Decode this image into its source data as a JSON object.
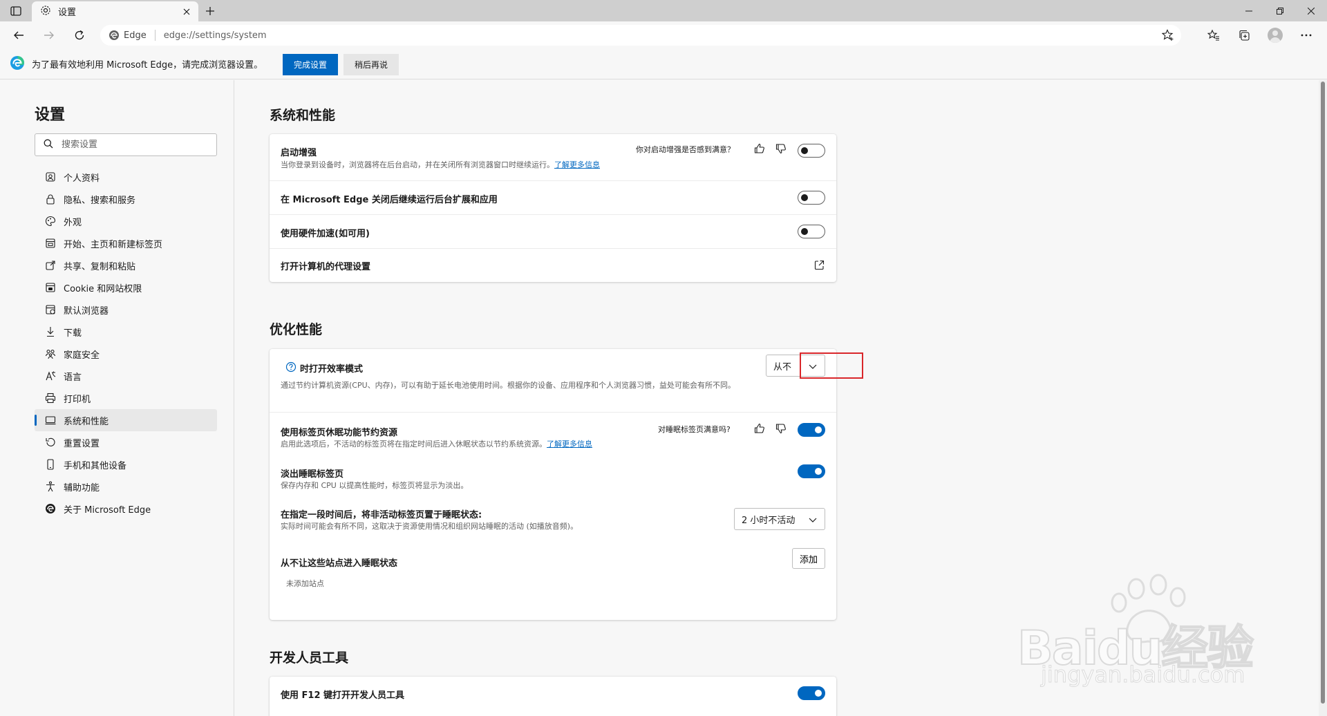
{
  "tab": {
    "title": "设置"
  },
  "address_bar": {
    "site_label": "Edge",
    "url": "edge://settings/system"
  },
  "infobar": {
    "message": "为了最有效地利用 Microsoft Edge，请完成浏览器设置。",
    "primary_button": "完成设置",
    "secondary_button": "稍后再说"
  },
  "sidebar": {
    "title": "设置",
    "search_placeholder": "搜索设置",
    "items": [
      {
        "label": "个人资料",
        "icon": "profile-icon"
      },
      {
        "label": "隐私、搜索和服务",
        "icon": "lock-icon"
      },
      {
        "label": "外观",
        "icon": "appearance-icon"
      },
      {
        "label": "开始、主页和新建标签页",
        "icon": "home-tab-icon"
      },
      {
        "label": "共享、复制和粘贴",
        "icon": "share-icon"
      },
      {
        "label": "Cookie 和网站权限",
        "icon": "site-permissions-icon"
      },
      {
        "label": "默认浏览器",
        "icon": "default-browser-icon"
      },
      {
        "label": "下载",
        "icon": "download-icon"
      },
      {
        "label": "家庭安全",
        "icon": "family-icon"
      },
      {
        "label": "语言",
        "icon": "language-icon"
      },
      {
        "label": "打印机",
        "icon": "printer-icon"
      },
      {
        "label": "系统和性能",
        "icon": "system-icon",
        "active": true
      },
      {
        "label": "重置设置",
        "icon": "reset-icon"
      },
      {
        "label": "手机和其他设备",
        "icon": "phone-icon"
      },
      {
        "label": "辅助功能",
        "icon": "accessibility-icon"
      },
      {
        "label": "关于 Microsoft Edge",
        "icon": "edge-logo-icon"
      }
    ]
  },
  "system_section": {
    "title": "系统和性能",
    "startup_boost": {
      "title": "启动增强",
      "desc": "当你登录到设备时，浏览器将在后台启动，并在关闭所有浏览器窗口时继续运行。",
      "link": "了解更多信息",
      "feedback_question": "你对启动增强是否感到满意？",
      "enabled": false
    },
    "background_extensions": {
      "title": "在 Microsoft Edge 关闭后继续运行后台扩展和应用",
      "enabled": false
    },
    "hardware_accel": {
      "title": "使用硬件加速(如可用)",
      "enabled": false
    },
    "proxy": {
      "title": "打开计算机的代理设置"
    }
  },
  "performance_section": {
    "title": "优化性能",
    "efficiency_mode": {
      "title": "时打开效率模式",
      "desc": "通过节约计算机资源(CPU、内存)，可以有助于延长电池使用时间。根据你的设备、应用程序和个人浏览器习惯，益处可能会有所不同。",
      "selected": "从不"
    },
    "sleeping_tabs": {
      "title": "使用标签页休眠功能节约资源",
      "desc": "启用此选项后，不活动的标签页将在指定时间后进入休眠状态以节约系统资源。",
      "link": "了解更多信息",
      "feedback_question": "对睡眠标签页满意吗?",
      "enabled": true
    },
    "fade_sleeping": {
      "title": "淡出睡眠标签页",
      "desc": "保存内存和 CPU 以提高性能时，标签页将显示为淡出。",
      "enabled": true
    },
    "sleep_after": {
      "title": "在指定一段时间后，将非活动标签页置于睡眠状态:",
      "desc": "实际时间可能会有所不同，这取决于资源使用情况和组织网站睡眠的活动 (如播放音频)。",
      "selected": "2 小时不活动"
    },
    "never_sleep": {
      "title": "从不让这些站点进入睡眠状态",
      "add_button": "添加",
      "empty_text": "未添加站点"
    }
  },
  "dev_section": {
    "title": "开发人员工具",
    "f12": {
      "title": "使用 F12 键打开开发人员工具",
      "enabled": true
    }
  },
  "watermark": {
    "text_main": "Baidu经验",
    "text_sub": "jingyan.baidu.com"
  },
  "colors": {
    "accent": "#0067c0",
    "highlight": "#d9262a"
  }
}
